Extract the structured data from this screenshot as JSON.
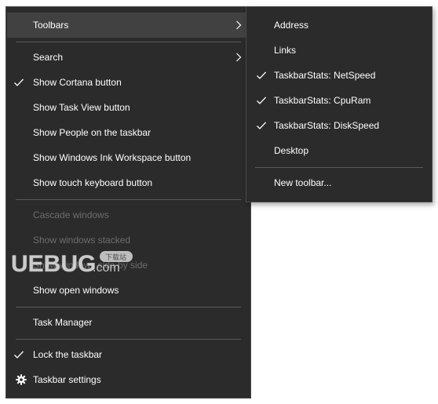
{
  "main_menu": {
    "items": [
      {
        "label": "Toolbars",
        "has_submenu": true,
        "highlighted": true
      },
      {
        "label": "Search",
        "has_submenu": true
      },
      {
        "label": "Show Cortana button",
        "checked": true
      },
      {
        "label": "Show Task View button"
      },
      {
        "label": "Show People on the taskbar"
      },
      {
        "label": "Show Windows Ink Workspace button"
      },
      {
        "label": "Show touch keyboard button"
      },
      {
        "label": "Cascade windows",
        "disabled": true
      },
      {
        "label": "Show windows stacked",
        "disabled": true
      },
      {
        "label": "Show windows side by side",
        "disabled": true
      },
      {
        "label": "Show open windows"
      },
      {
        "label": "Task Manager"
      },
      {
        "label": "Lock the taskbar",
        "checked": true
      },
      {
        "label": "Taskbar settings",
        "icon": "gear-icon"
      }
    ]
  },
  "sub_menu": {
    "items": [
      {
        "label": "Address"
      },
      {
        "label": "Links"
      },
      {
        "label": "TaskbarStats: NetSpeed",
        "checked": true
      },
      {
        "label": "TaskbarStats: CpuRam",
        "checked": true
      },
      {
        "label": "TaskbarStats: DiskSpeed",
        "checked": true
      },
      {
        "label": "Desktop"
      },
      {
        "label": "New toolbar..."
      }
    ]
  },
  "watermark": {
    "text": "UEBUG",
    "suffix": ".com",
    "badge": "下载站"
  },
  "colors": {
    "menu_bg": "#2b2b2b",
    "highlight_bg": "#414141",
    "text": "#ffffff",
    "disabled_text": "#6d6d6d",
    "separator": "#5a5a5a"
  }
}
